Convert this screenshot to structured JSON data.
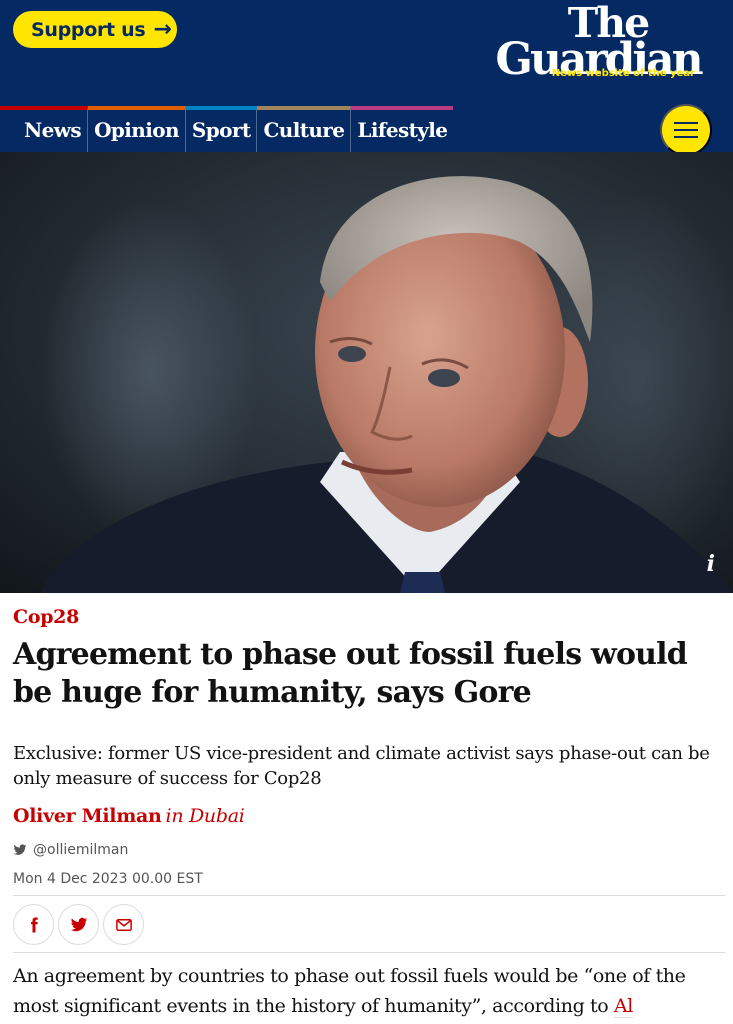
{
  "header": {
    "support_label": "Support us",
    "support_arrow": "→",
    "logo_line1": "The",
    "logo_line2": "Guardian",
    "logo_tagline": "News website of the year",
    "menu_icon": "hamburger-menu-icon"
  },
  "nav": {
    "items": [
      {
        "label": "News",
        "color": "#c70000"
      },
      {
        "label": "Opinion",
        "color": "#e05e00"
      },
      {
        "label": "Sport",
        "color": "#0084c6"
      },
      {
        "label": "Culture",
        "color": "#a1845c"
      },
      {
        "label": "Lifestyle",
        "color": "#bb3b80"
      }
    ]
  },
  "hero": {
    "info_label": "i"
  },
  "article": {
    "kicker": "Cop28",
    "headline": "Agreement to phase out fossil fuels would be huge for humanity, says Gore",
    "standfirst": "Exclusive: former US vice-president and climate activist says phase-out can be only measure of success for Cop28",
    "author": "Oliver Milman",
    "location": "in Dubai",
    "twitter_handle": "@olliemilman",
    "date": "Mon 4 Dec 2023 00.00 EST",
    "body_start": "An agreement by countries to phase out fossil fuels would be “one of the most significant events in the history of humanity”, according to ",
    "body_link": "Al"
  },
  "share": {
    "icons": [
      "facebook-icon",
      "twitter-icon",
      "email-icon"
    ]
  },
  "colors": {
    "brand_blue": "#052962",
    "brand_yellow": "#ffe500",
    "news_red": "#c70000"
  }
}
